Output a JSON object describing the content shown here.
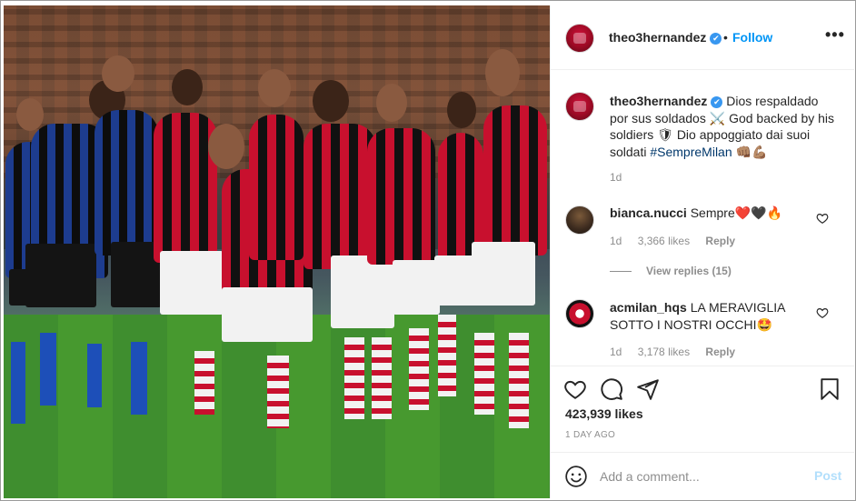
{
  "post": {
    "username": "theo3hernandez",
    "follow_label": "Follow",
    "more_label": "•••",
    "separator": "•",
    "verified_mark": "✔"
  },
  "caption": {
    "username": "theo3hernandez",
    "text_1": "Dios respaldado por sus soldados",
    "emoji_1": "⚔️",
    "text_2": "God backed by his soldiers",
    "emoji_2": "🛡",
    "text_3": "Dio appoggiato dai suoi soldati",
    "hashtag": "#SempreMilan",
    "emoji_3": "👊🏽💪🏽",
    "time": "1d"
  },
  "comments": [
    {
      "username": "bianca.nucci",
      "text": "Sempre",
      "emoji": "❤️🖤🔥",
      "time": "1d",
      "likes": "3,366 likes",
      "reply_label": "Reply",
      "view_replies": "View replies (15)"
    },
    {
      "username": "acmilan_hqs",
      "text": "LA MERAVIGLIA SOTTO I NOSTRI OCCHI",
      "emoji": "🤩",
      "time": "1d",
      "likes": "3,178 likes",
      "reply_label": "Reply"
    }
  ],
  "actions": {
    "likes": "423,939 likes",
    "posted": "1 DAY AGO",
    "icons": [
      "heart-icon",
      "comment-icon",
      "share-icon",
      "bookmark-icon"
    ]
  },
  "add_comment": {
    "placeholder": "Add a comment...",
    "post_label": "Post"
  },
  "colors": {
    "accent": "#0095f6",
    "verified": "#3897f0",
    "post_disabled": "#b2dffc",
    "muted": "#8e8e8e",
    "milan_red": "#c8102e"
  }
}
